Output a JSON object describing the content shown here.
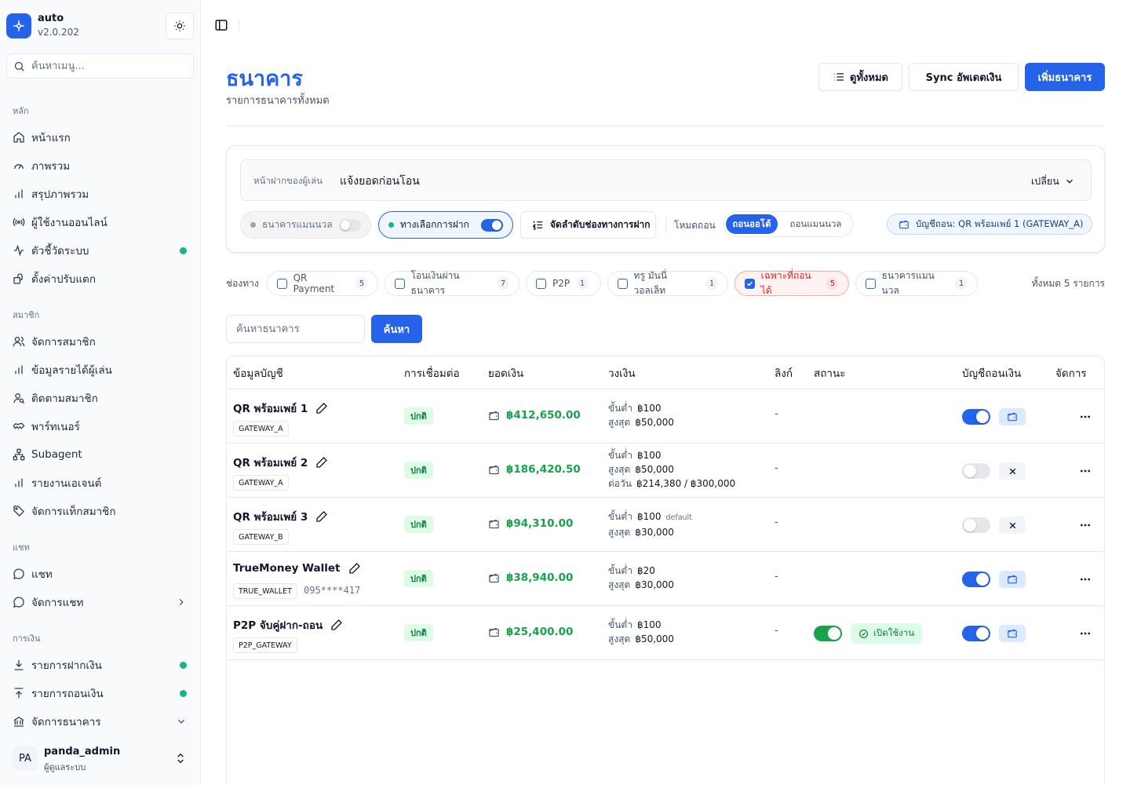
{
  "app": {
    "name": "auto",
    "version": "v2.0.202"
  },
  "sidebar": {
    "search_placeholder": "ค้นหาเมนู...",
    "groups": [
      {
        "label": "หลัก",
        "items": [
          {
            "label": "หน้าแรก",
            "icon": "home-icon"
          },
          {
            "label": "ภาพรวม",
            "icon": "gauge-icon"
          },
          {
            "label": "สรุปภาพรวม",
            "icon": "bar-chart-icon"
          },
          {
            "label": "ผู้ใช้งานออนไลน์",
            "icon": "broadcast-icon"
          },
          {
            "label": "ตัวชี้วัดระบบ",
            "icon": "activity-icon",
            "dot": true
          },
          {
            "label": "ตั้งค่าปรับแตก",
            "icon": "package-icon"
          }
        ]
      },
      {
        "label": "สมาชิก",
        "items": [
          {
            "label": "จัดการสมาชิก",
            "icon": "users-icon"
          },
          {
            "label": "ข้อมูลรายได้ผู้เล่น",
            "icon": "bar-chart-icon"
          },
          {
            "label": "ติดตามสมาชิก",
            "icon": "user-search-icon"
          },
          {
            "label": "พาร์ทเนอร์",
            "icon": "handshake-icon"
          },
          {
            "label": "Subagent",
            "icon": "network-icon"
          },
          {
            "label": "รายงานเอเจนต์",
            "icon": "bar-chart-icon"
          },
          {
            "label": "จัดการแท็กสมาชิก",
            "icon": "tag-icon"
          }
        ]
      },
      {
        "label": "แชท",
        "items": [
          {
            "label": "แชท",
            "icon": "chat-icon"
          },
          {
            "label": "จัดการแชท",
            "icon": "chat-icon",
            "chevron": "right"
          }
        ]
      },
      {
        "label": "การเงิน",
        "items": [
          {
            "label": "รายการฝากเงิน",
            "icon": "download-icon",
            "dot": true
          },
          {
            "label": "รายการถอนเงิน",
            "icon": "upload-icon",
            "dot": true
          },
          {
            "label": "จัดการธนาคาร",
            "icon": "bank-icon",
            "chevron": "down"
          }
        ]
      }
    ],
    "user": {
      "initials": "PA",
      "name": "panda_admin",
      "role": "ผู้ดูแลระบบ"
    }
  },
  "header": {
    "title": "ธนาคาร",
    "subtitle": "รายการธนาคารทั้งหมด",
    "view_all": "ดูทั้งหมด",
    "sync": "Sync อัพเดตเงิน",
    "add": "เพิ่มธนาคาร"
  },
  "settings": {
    "deposit_label": "หน้าฝากของผู้เล่น",
    "deposit_value": "แจ้งยอดก่อนโอน",
    "change": "เปลี่ยน",
    "manual_bank": "ธนาคารแมนนวล",
    "deposit_options": "ทางเลือกการฝาก",
    "order_channels": "จัดลำดับช่องทางการฝาก",
    "withdraw_mode_label": "โหมดถอน",
    "mode_auto": "ถอนออโต้",
    "mode_manual": "ถอนแมนนวล",
    "withdraw_account": "บัญชีถอน: QR พร้อมเพย์ 1 (GATEWAY_A)"
  },
  "filters": {
    "label": "ช่องทาง",
    "chips": [
      {
        "label": "QR Payment",
        "count": "5",
        "checked": false
      },
      {
        "label": "โอนเงินผ่านธนาคาร",
        "count": "7",
        "checked": false
      },
      {
        "label": "P2P",
        "count": "1",
        "checked": false
      },
      {
        "label": "ทรู มันนี่ วอลเล็ท",
        "count": "1",
        "checked": false
      },
      {
        "label": "เฉพาะที่ถอนได้",
        "count": "5",
        "checked": true
      },
      {
        "label": "ธนาคารแมนนวล",
        "count": "1",
        "checked": false
      }
    ],
    "total": "ทั้งหมด 5 รายการ"
  },
  "search": {
    "placeholder": "ค้นหาธนาคาร",
    "button": "ค้นหา"
  },
  "table": {
    "columns": [
      "ข้อมูลบัญชี",
      "การเชื่อมต่อ",
      "ยอดเงิน",
      "วงเงิน",
      "ลิงก์",
      "สถานะ",
      "บัญชีถอนเงิน",
      "จัดการ"
    ],
    "rows": [
      {
        "name": "QR พร้อมเพย์ 1",
        "code": "GATEWAY_A",
        "phone": "",
        "connection": "ปกติ",
        "balance": "฿412,650.00",
        "limits": [
          {
            "k": "ขั้นต่ำ",
            "v": "฿100",
            "note": ""
          },
          {
            "k": "สูงสุด",
            "v": "฿50,000",
            "note": ""
          }
        ],
        "link": "-",
        "status": null,
        "withdraw_on": true
      },
      {
        "name": "QR พร้อมเพย์ 2",
        "code": "GATEWAY_A",
        "phone": "",
        "connection": "ปกติ",
        "balance": "฿186,420.50",
        "limits": [
          {
            "k": "ขั้นต่ำ",
            "v": "฿100",
            "note": ""
          },
          {
            "k": "สูงสุด",
            "v": "฿50,000",
            "note": ""
          },
          {
            "k": "ต่อวัน",
            "v": "฿214,380 / ฿300,000",
            "note": ""
          }
        ],
        "link": "-",
        "status": null,
        "withdraw_on": false
      },
      {
        "name": "QR พร้อมเพย์ 3",
        "code": "GATEWAY_B",
        "phone": "",
        "connection": "ปกติ",
        "balance": "฿94,310.00",
        "limits": [
          {
            "k": "ขั้นต่ำ",
            "v": "฿100",
            "note": "default"
          },
          {
            "k": "สูงสุด",
            "v": "฿30,000",
            "note": ""
          }
        ],
        "link": "-",
        "status": null,
        "withdraw_on": false
      },
      {
        "name": "TrueMoney Wallet",
        "code": "TRUE_WALLET",
        "phone": "095****417",
        "connection": "ปกติ",
        "balance": "฿38,940.00",
        "limits": [
          {
            "k": "ขั้นต่ำ",
            "v": "฿20",
            "note": ""
          },
          {
            "k": "สูงสุด",
            "v": "฿30,000",
            "note": ""
          }
        ],
        "link": "-",
        "status": null,
        "withdraw_on": true
      },
      {
        "name": "P2P จับคู่ฝาก-ถอน",
        "code": "P2P_GATEWAY",
        "phone": "",
        "connection": "ปกติ",
        "balance": "฿25,400.00",
        "limits": [
          {
            "k": "ขั้นต่ำ",
            "v": "฿100",
            "note": ""
          },
          {
            "k": "สูงสุด",
            "v": "฿50,000",
            "note": ""
          }
        ],
        "link": "-",
        "status": "เปิดใช้งาน",
        "withdraw_on": true
      }
    ]
  }
}
